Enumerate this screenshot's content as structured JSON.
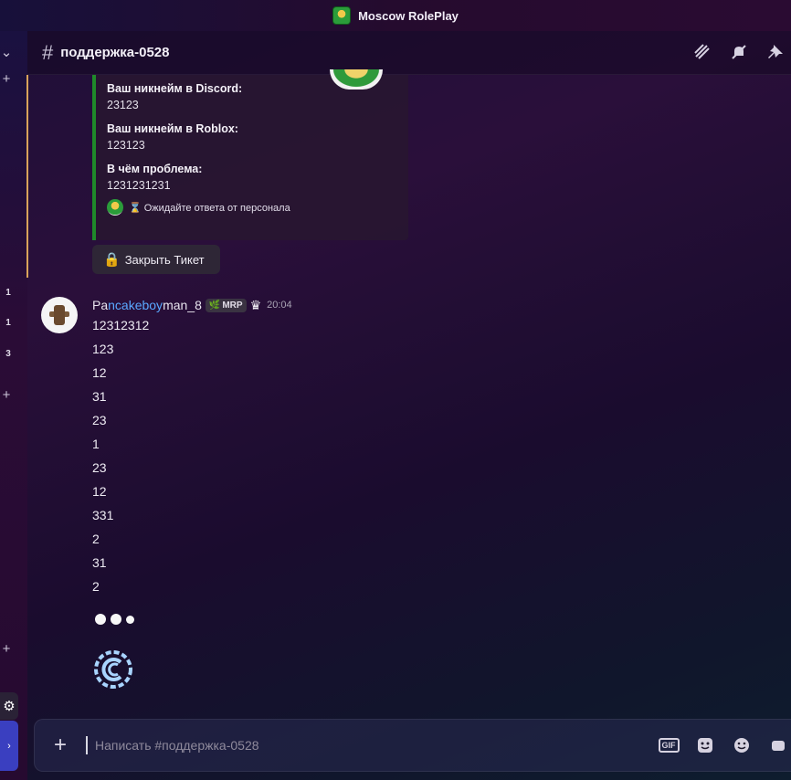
{
  "window": {
    "title": "Moscow RolePlay"
  },
  "rail": {
    "counts": [
      "1",
      "1",
      "3"
    ]
  },
  "header": {
    "channel_name": "поддержка-0528"
  },
  "embed": {
    "fields": [
      {
        "name": "Ваш никнейм в Discord:",
        "value": "23123"
      },
      {
        "name": "Ваш никнейм в Roblox:",
        "value": "123123"
      },
      {
        "name": "В чём проблема:",
        "value": "1231231231"
      }
    ],
    "footer_text": "⌛ Ожидайте ответа от персонала"
  },
  "close_ticket_label": "Закрыть Тикет",
  "message": {
    "author_pre": "Pa",
    "author_mid": "ncakeboy",
    "author_post": "man_8",
    "tag": "MRP",
    "time": "20:04",
    "lines": [
      "12312312",
      "123",
      "12",
      "31",
      "23",
      "1",
      "23",
      "12",
      "331",
      "2",
      "31",
      "2"
    ]
  },
  "composer": {
    "placeholder": "Написать #поддержка-0528"
  },
  "icons": [
    "chevron-down-icon",
    "plus-icon",
    "hash-icon",
    "threads-icon",
    "mute-icon",
    "pin-icon",
    "lock-icon",
    "crown-icon",
    "gif-icon",
    "sticker-icon",
    "emoji-icon",
    "gear-icon"
  ]
}
